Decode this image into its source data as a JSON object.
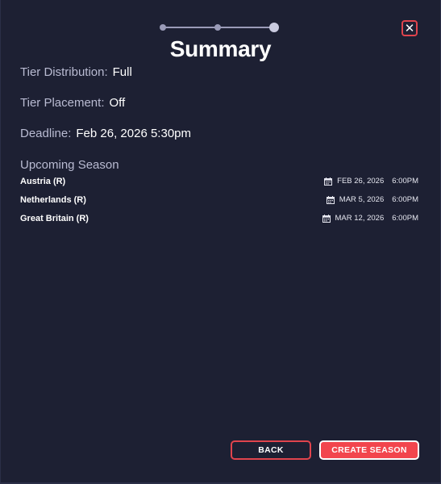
{
  "header": {
    "title": "Summary",
    "stepper": {
      "total_steps": 3,
      "current_step": 3
    },
    "close_icon": "close-icon"
  },
  "summary": {
    "tier_distribution": {
      "label": "Tier Distribution:",
      "value": "Full"
    },
    "tier_placement": {
      "label": "Tier Placement:",
      "value": "Off"
    },
    "deadline": {
      "label": "Deadline:",
      "value": "Feb 26, 2026 5:30pm"
    }
  },
  "upcoming": {
    "title": "Upcoming Season",
    "icon": "calendar-icon",
    "races": [
      {
        "name": "Austria (R)",
        "date": "FEB 26, 2026",
        "time": "6:00PM"
      },
      {
        "name": "Netherlands (R)",
        "date": "MAR 5, 2026",
        "time": "6:00PM"
      },
      {
        "name": "Great Britain (R)",
        "date": "MAR 12, 2026",
        "time": "6:00PM"
      }
    ]
  },
  "footer": {
    "back_label": "BACK",
    "create_label": "CREATE SEASON"
  },
  "colors": {
    "background": "#1d2033",
    "accent": "#f2454d",
    "muted_text": "#b9bbd2"
  }
}
